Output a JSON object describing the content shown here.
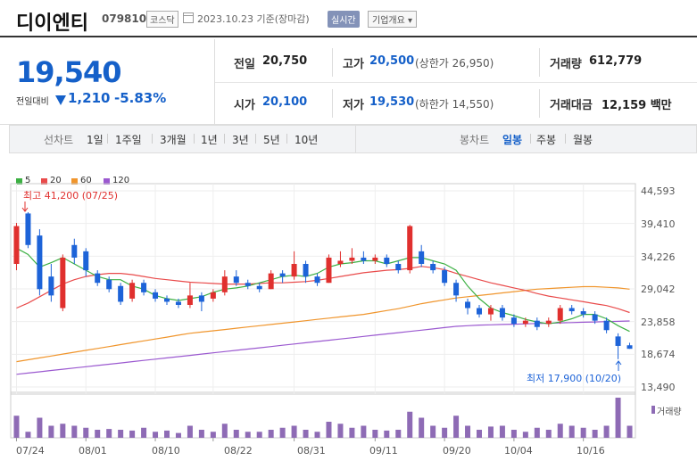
{
  "header": {
    "name": "디이엔티",
    "code": "079810",
    "market": "코스닥",
    "date": "2023.10.23  기준(장마감)",
    "live_btn": "실시간",
    "corp_btn": "기업개요 ▾"
  },
  "quote": {
    "price": "19,540",
    "change_label": "전일대비",
    "change": "1,210",
    "change_pct": "-5.83%",
    "prev_close_label": "전일",
    "prev_close": "20,750",
    "high_label": "고가",
    "high": "20,500",
    "upper_limit": "(상한가 26,950)",
    "volume_label": "거래량",
    "volume": "612,779",
    "open_label": "시가",
    "open": "20,100",
    "low_label": "저가",
    "low": "19,530",
    "lower_limit": "(하한가 14,550)",
    "amount_label": "거래대금",
    "amount": "12,159 백만"
  },
  "tabs": {
    "line_label": "선차트",
    "line_periods": [
      "1일",
      "1주일",
      "3개월",
      "1년",
      "3년",
      "5년",
      "10년"
    ],
    "candle_label": "봉차트",
    "candle_periods": [
      "일봉",
      "주봉",
      "월봉"
    ],
    "active_candle": "일봉"
  },
  "legend": [
    {
      "label": "5",
      "color": "#3cb043"
    },
    {
      "label": "20",
      "color": "#e94b4b"
    },
    {
      "label": "60",
      "color": "#f0952c"
    },
    {
      "label": "120",
      "color": "#9b59d0"
    }
  ],
  "annotations": {
    "high": "최고 41,200 (07/25)",
    "low": "최저 17,900 (10/20)",
    "volume_label": "거래량"
  },
  "colors": {
    "up": "#e0302e",
    "down": "#1d63d8",
    "volume": "#8e6bb5",
    "ma5": "#3cb043",
    "ma20": "#e94b4b",
    "ma60": "#f0952c",
    "ma120": "#9b59d0"
  },
  "chart_data": {
    "type": "candlestick",
    "ylabels": [
      "44,593",
      "39,410",
      "34,226",
      "29,042",
      "23,858",
      "18,674",
      "13,490"
    ],
    "yticks": [
      44593,
      39410,
      34226,
      29042,
      23858,
      18674,
      13490
    ],
    "ylim": [
      13490,
      44593
    ],
    "xlabels": [
      "07/24",
      "08/01",
      "08/10",
      "08/22",
      "08/31",
      "09/11",
      "09/20",
      "10/04",
      "10/16"
    ],
    "xlabel_index": [
      0,
      6,
      12,
      17,
      24,
      31,
      37,
      43,
      49
    ],
    "candles": [
      {
        "o": 33000,
        "c": 39000,
        "h": 39500,
        "l": 32000
      },
      {
        "o": 41000,
        "c": 36000,
        "h": 41200,
        "l": 35500
      },
      {
        "o": 37500,
        "c": 29000,
        "h": 38500,
        "l": 28000
      },
      {
        "o": 31000,
        "c": 28000,
        "h": 33000,
        "l": 27000
      },
      {
        "o": 26000,
        "c": 34000,
        "h": 34500,
        "l": 25500
      },
      {
        "o": 36000,
        "c": 34000,
        "h": 37000,
        "l": 33000
      },
      {
        "o": 35000,
        "c": 32000,
        "h": 35500,
        "l": 31000
      },
      {
        "o": 31500,
        "c": 30000,
        "h": 32000,
        "l": 29500
      },
      {
        "o": 30500,
        "c": 29000,
        "h": 31000,
        "l": 28500
      },
      {
        "o": 29500,
        "c": 27000,
        "h": 30000,
        "l": 26500
      },
      {
        "o": 27500,
        "c": 30000,
        "h": 30500,
        "l": 27000
      },
      {
        "o": 30000,
        "c": 28500,
        "h": 30500,
        "l": 28000
      },
      {
        "o": 28500,
        "c": 27500,
        "h": 29000,
        "l": 27000
      },
      {
        "o": 27500,
        "c": 27000,
        "h": 28000,
        "l": 26500
      },
      {
        "o": 27000,
        "c": 26500,
        "h": 27500,
        "l": 26000
      },
      {
        "o": 26500,
        "c": 28000,
        "h": 30000,
        "l": 26000
      },
      {
        "o": 28000,
        "c": 27000,
        "h": 28500,
        "l": 25500
      },
      {
        "o": 27500,
        "c": 28500,
        "h": 29000,
        "l": 27000
      },
      {
        "o": 28500,
        "c": 31000,
        "h": 32000,
        "l": 28000
      },
      {
        "o": 31000,
        "c": 30000,
        "h": 32000,
        "l": 29500
      },
      {
        "o": 30000,
        "c": 29500,
        "h": 30500,
        "l": 29000
      },
      {
        "o": 29500,
        "c": 29000,
        "h": 30000,
        "l": 28500
      },
      {
        "o": 29000,
        "c": 31500,
        "h": 32000,
        "l": 29000
      },
      {
        "o": 31500,
        "c": 31000,
        "h": 32000,
        "l": 30000
      },
      {
        "o": 31000,
        "c": 33000,
        "h": 35000,
        "l": 30500
      },
      {
        "o": 33000,
        "c": 31000,
        "h": 33500,
        "l": 30000
      },
      {
        "o": 31000,
        "c": 30000,
        "h": 31500,
        "l": 29500
      },
      {
        "o": 30000,
        "c": 34000,
        "h": 34500,
        "l": 30000
      },
      {
        "o": 33000,
        "c": 33500,
        "h": 35000,
        "l": 32500
      },
      {
        "o": 33500,
        "c": 34000,
        "h": 35500,
        "l": 33000
      },
      {
        "o": 34000,
        "c": 33500,
        "h": 35000,
        "l": 33000
      },
      {
        "o": 33500,
        "c": 34000,
        "h": 34500,
        "l": 33000
      },
      {
        "o": 34000,
        "c": 33000,
        "h": 34500,
        "l": 32500
      },
      {
        "o": 33000,
        "c": 32000,
        "h": 33500,
        "l": 31500
      },
      {
        "o": 32000,
        "c": 39000,
        "h": 39200,
        "l": 31500
      },
      {
        "o": 35000,
        "c": 33000,
        "h": 36000,
        "l": 32500
      },
      {
        "o": 33000,
        "c": 32000,
        "h": 33500,
        "l": 31500
      },
      {
        "o": 32000,
        "c": 30000,
        "h": 32500,
        "l": 29500
      },
      {
        "o": 30000,
        "c": 28000,
        "h": 30500,
        "l": 27000
      },
      {
        "o": 27000,
        "c": 26000,
        "h": 27500,
        "l": 25000
      },
      {
        "o": 26000,
        "c": 25000,
        "h": 26500,
        "l": 24500
      },
      {
        "o": 25000,
        "c": 26000,
        "h": 26500,
        "l": 24000
      },
      {
        "o": 26000,
        "c": 24500,
        "h": 26500,
        "l": 24000
      },
      {
        "o": 24500,
        "c": 23500,
        "h": 25000,
        "l": 23000
      },
      {
        "o": 23500,
        "c": 24000,
        "h": 24500,
        "l": 23000
      },
      {
        "o": 24000,
        "c": 23000,
        "h": 24500,
        "l": 22500
      },
      {
        "o": 23500,
        "c": 24000,
        "h": 24500,
        "l": 23000
      },
      {
        "o": 24000,
        "c": 26000,
        "h": 26500,
        "l": 23500
      },
      {
        "o": 26000,
        "c": 25500,
        "h": 26500,
        "l": 25000
      },
      {
        "o": 25500,
        "c": 25000,
        "h": 26000,
        "l": 24500
      },
      {
        "o": 25000,
        "c": 24000,
        "h": 25500,
        "l": 23500
      },
      {
        "o": 24000,
        "c": 22500,
        "h": 24500,
        "l": 22000
      },
      {
        "o": 21500,
        "c": 20000,
        "h": 22000,
        "l": 17900
      },
      {
        "o": 20100,
        "c": 19540,
        "h": 20500,
        "l": 19530
      }
    ],
    "ma5": [
      35500,
      34500,
      32500,
      33200,
      34000,
      33000,
      32000,
      31000,
      30500,
      30500,
      29500,
      29000,
      28000,
      27500,
      27200,
      27500,
      27800,
      28500,
      29000,
      29200,
      29500,
      30000,
      30500,
      31000,
      31200,
      31000,
      31500,
      32500,
      33000,
      33200,
      33500,
      33500,
      33000,
      33500,
      34000,
      34000,
      33500,
      33000,
      32000,
      29500,
      27500,
      26000,
      25300,
      24800,
      24200,
      23800,
      23500,
      23800,
      24300,
      25000,
      25000,
      24300,
      23200,
      22300
    ],
    "ma20": [
      26000,
      26800,
      27800,
      28800,
      29800,
      30500,
      31000,
      31300,
      31500,
      31500,
      31300,
      31000,
      30700,
      30500,
      30300,
      30100,
      30000,
      29900,
      29800,
      29800,
      29800,
      29900,
      30000,
      30000,
      30100,
      30200,
      30400,
      30700,
      31000,
      31300,
      31600,
      31800,
      32000,
      32100,
      32300,
      32600,
      32400,
      32100,
      31500,
      31000,
      30500,
      30000,
      29600,
      29200,
      28800,
      28300,
      27900,
      27600,
      27300,
      27000,
      26700,
      26400,
      25900,
      25300
    ],
    "ma60": [
      17500,
      17800,
      18100,
      18400,
      18700,
      19000,
      19300,
      19600,
      19900,
      20200,
      20500,
      20800,
      21100,
      21400,
      21700,
      22000,
      22200,
      22400,
      22600,
      22800,
      23000,
      23200,
      23400,
      23600,
      23800,
      24000,
      24200,
      24400,
      24600,
      24800,
      25000,
      25300,
      25600,
      25900,
      26300,
      26700,
      27000,
      27300,
      27600,
      27800,
      28000,
      28200,
      28400,
      28600,
      28800,
      29000,
      29100,
      29200,
      29300,
      29400,
      29400,
      29300,
      29200,
      29000
    ],
    "ma120": [
      15500,
      15700,
      15900,
      16100,
      16300,
      16500,
      16700,
      16900,
      17100,
      17300,
      17500,
      17700,
      17900,
      18100,
      18300,
      18500,
      18700,
      18900,
      19100,
      19300,
      19500,
      19700,
      19900,
      20100,
      20300,
      20500,
      20700,
      20900,
      21100,
      21300,
      21500,
      21700,
      21900,
      22100,
      22300,
      22500,
      22700,
      22900,
      23100,
      23200,
      23300,
      23350,
      23400,
      23450,
      23500,
      23550,
      23600,
      23650,
      23700,
      23750,
      23800,
      23850,
      23900,
      23950
    ],
    "volume": [
      0.55,
      0.15,
      0.5,
      0.3,
      0.35,
      0.3,
      0.25,
      0.2,
      0.22,
      0.2,
      0.18,
      0.25,
      0.15,
      0.18,
      0.12,
      0.3,
      0.2,
      0.15,
      0.35,
      0.2,
      0.15,
      0.15,
      0.2,
      0.25,
      0.3,
      0.2,
      0.15,
      0.4,
      0.35,
      0.25,
      0.3,
      0.2,
      0.18,
      0.2,
      0.65,
      0.5,
      0.3,
      0.25,
      0.55,
      0.3,
      0.2,
      0.28,
      0.3,
      0.2,
      0.15,
      0.25,
      0.2,
      0.35,
      0.3,
      0.25,
      0.2,
      0.3,
      1.0,
      0.3
    ]
  }
}
